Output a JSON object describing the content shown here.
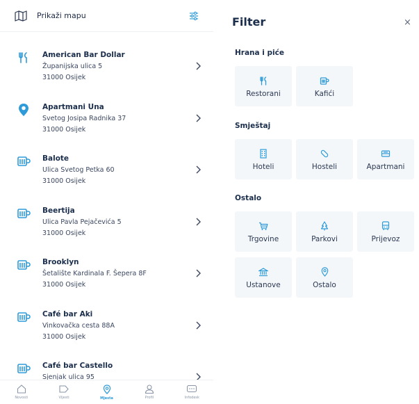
{
  "left": {
    "topbar": {
      "map_label": "Prikaži mapu",
      "map_icon": "map-icon",
      "filter_icon": "filter-sliders-icon"
    },
    "places": [
      {
        "name": "American Bar Dollar",
        "address": "Županijska ulica 5",
        "city": "31000 Osijek",
        "icon": "restaurant-icon"
      },
      {
        "name": "Apartmani Una",
        "address": "Svetog Josipa Radnika 37",
        "city": "31000 Osijek",
        "icon": "location-pin-icon"
      },
      {
        "name": "Balote",
        "address": "Ulica Svetog Petka 60",
        "city": "31000 Osijek",
        "icon": "coffee-cup-icon"
      },
      {
        "name": "Beertija",
        "address": "Ulica Pavla Pejačevića 5",
        "city": "31000 Osijek",
        "icon": "coffee-cup-icon"
      },
      {
        "name": "Brooklyn",
        "address": "Šetalište Kardinala F. Šepera 8F",
        "city": "31000 Osijek",
        "icon": "coffee-cup-icon"
      },
      {
        "name": "Café bar Aki",
        "address": "Vinkovačka cesta 88A",
        "city": "31000 Osijek",
        "icon": "coffee-cup-icon"
      },
      {
        "name": "Café bar Castello",
        "address": "Sjenjak ulica 95",
        "city": "",
        "icon": "coffee-cup-icon"
      }
    ],
    "nav": [
      {
        "label": "Novosti",
        "icon": "home-icon",
        "active": false
      },
      {
        "label": "Vijesti",
        "icon": "tag-icon",
        "active": false
      },
      {
        "label": "Mjesta",
        "icon": "location-pin-icon",
        "active": true
      },
      {
        "label": "Profil",
        "icon": "user-icon",
        "active": false
      },
      {
        "label": "Infodesk",
        "icon": "chat-icon",
        "active": false
      }
    ]
  },
  "filter": {
    "title": "Filter",
    "close_label": "×",
    "sections": [
      {
        "title": "Hrana i piće",
        "items": [
          {
            "label": "Restorani",
            "icon": "restaurant-icon"
          },
          {
            "label": "Kafići",
            "icon": "coffee-cup-icon"
          }
        ]
      },
      {
        "title": "Smještaj",
        "items": [
          {
            "label": "Hoteli",
            "icon": "hotel-building-icon"
          },
          {
            "label": "Hosteli",
            "icon": "pill-tag-icon"
          },
          {
            "label": "Apartmani",
            "icon": "bed-icon"
          }
        ]
      },
      {
        "title": "Ostalo",
        "items": [
          {
            "label": "Trgovine",
            "icon": "shopping-cart-icon"
          },
          {
            "label": "Parkovi",
            "icon": "tree-icon"
          },
          {
            "label": "Prijevoz",
            "icon": "bus-icon"
          },
          {
            "label": "Ustanove",
            "icon": "institution-icon"
          },
          {
            "label": "Ostalo",
            "icon": "location-pin-icon"
          }
        ]
      }
    ]
  },
  "colors": {
    "accent": "#2e9bd8",
    "text_dark": "#1b2e4b",
    "tile_bg": "#f4f7fa"
  }
}
